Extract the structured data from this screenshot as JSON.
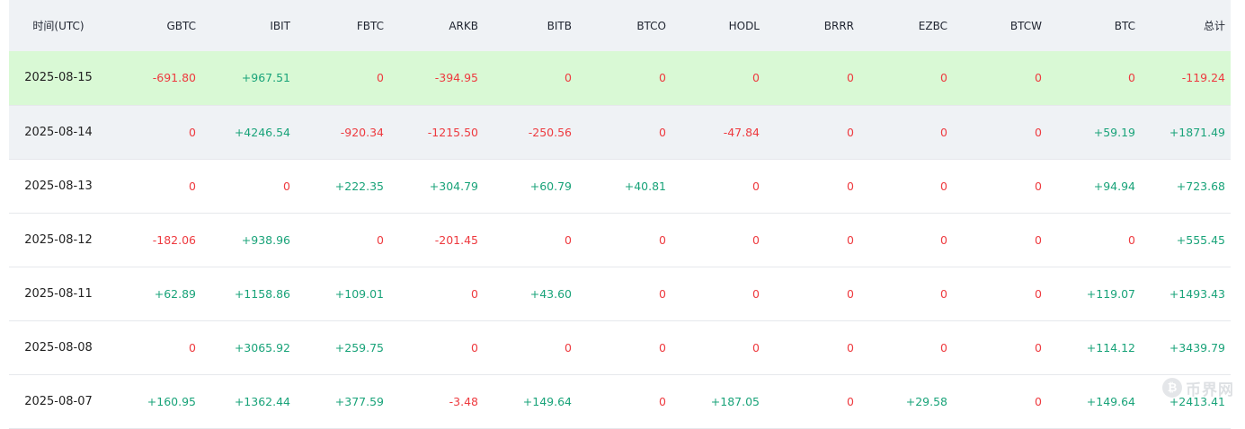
{
  "columns": [
    "时间(UTC)",
    "GBTC",
    "IBIT",
    "FBTC",
    "ARKB",
    "BITB",
    "BTCO",
    "HODL",
    "BRRR",
    "EZBC",
    "BTCW",
    "BTC",
    "总计"
  ],
  "rows": [
    {
      "date": "2025-08-15",
      "values": [
        "-691.80",
        "+967.51",
        "0",
        "-394.95",
        "0",
        "0",
        "0",
        "0",
        "0",
        "0",
        "0",
        "-119.24"
      ]
    },
    {
      "date": "2025-08-14",
      "values": [
        "0",
        "+4246.54",
        "-920.34",
        "-1215.50",
        "-250.56",
        "0",
        "-47.84",
        "0",
        "0",
        "0",
        "+59.19",
        "+1871.49"
      ]
    },
    {
      "date": "2025-08-13",
      "values": [
        "0",
        "0",
        "+222.35",
        "+304.79",
        "+60.79",
        "+40.81",
        "0",
        "0",
        "0",
        "0",
        "+94.94",
        "+723.68"
      ]
    },
    {
      "date": "2025-08-12",
      "values": [
        "-182.06",
        "+938.96",
        "0",
        "-201.45",
        "0",
        "0",
        "0",
        "0",
        "0",
        "0",
        "0",
        "+555.45"
      ]
    },
    {
      "date": "2025-08-11",
      "values": [
        "+62.89",
        "+1158.86",
        "+109.01",
        "0",
        "+43.60",
        "0",
        "0",
        "0",
        "0",
        "0",
        "+119.07",
        "+1493.43"
      ]
    },
    {
      "date": "2025-08-08",
      "values": [
        "0",
        "+3065.92",
        "+259.75",
        "0",
        "0",
        "0",
        "0",
        "0",
        "0",
        "0",
        "+114.12",
        "+3439.79"
      ]
    },
    {
      "date": "2025-08-07",
      "values": [
        "+160.95",
        "+1362.44",
        "+377.59",
        "-3.48",
        "+149.64",
        "0",
        "+187.05",
        "0",
        "+29.58",
        "0",
        "+149.64",
        "+2413.41"
      ]
    }
  ],
  "colors": {
    "positive": "#19a379",
    "negative": "#ee3a3f",
    "header_bg": "#eff2f5",
    "highlight_bg": "#d9f9d5"
  },
  "watermark": {
    "icon": "bitcoin-coin-icon",
    "glyph": "₿",
    "text": "币界网"
  }
}
